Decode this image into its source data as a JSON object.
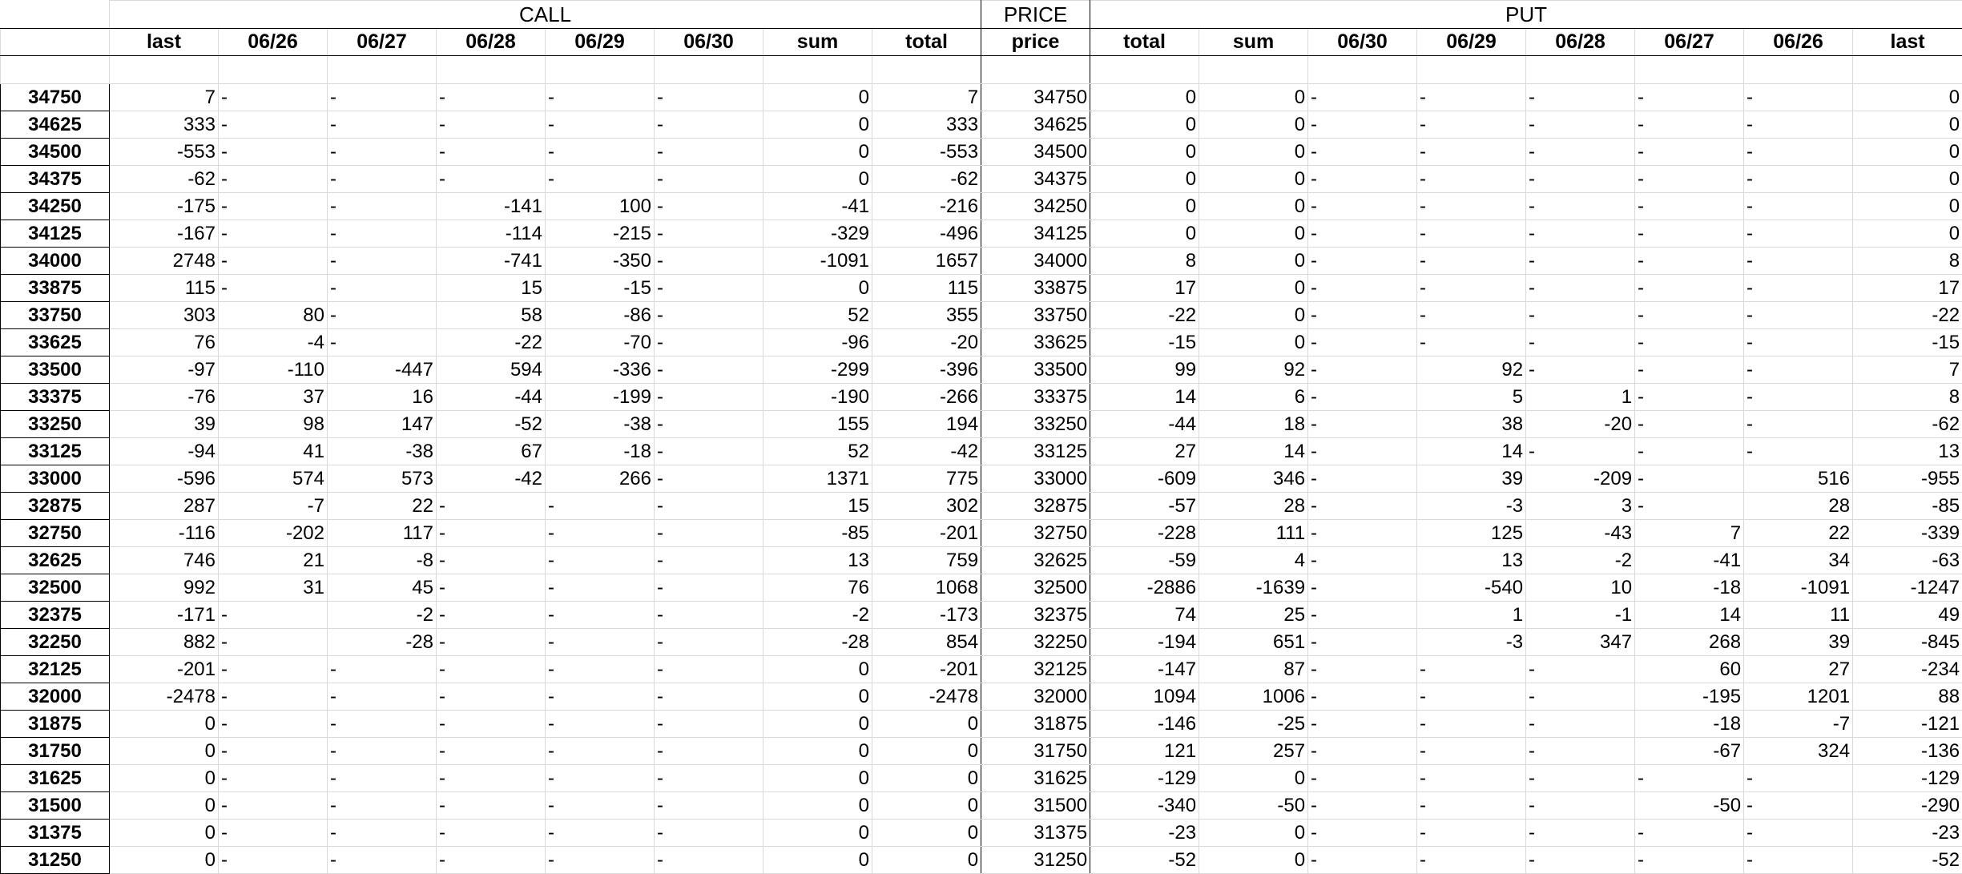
{
  "groups": {
    "call": "CALL",
    "price": "PRICE",
    "put": "PUT"
  },
  "headers": [
    "",
    "last",
    "06/26",
    "06/27",
    "06/28",
    "06/29",
    "06/30",
    "sum",
    "total",
    "price",
    "total",
    "sum",
    "06/30",
    "06/29",
    "06/28",
    "06/27",
    "06/26",
    "last"
  ],
  "rows": [
    [
      "34750",
      "7",
      "-",
      "-",
      "-",
      "-",
      "-",
      "0",
      "7",
      "34750",
      "0",
      "0",
      "-",
      "-",
      "-",
      "-",
      "-",
      "0"
    ],
    [
      "34625",
      "333",
      "-",
      "-",
      "-",
      "-",
      "-",
      "0",
      "333",
      "34625",
      "0",
      "0",
      "-",
      "-",
      "-",
      "-",
      "-",
      "0"
    ],
    [
      "34500",
      "-553",
      "-",
      "-",
      "-",
      "-",
      "-",
      "0",
      "-553",
      "34500",
      "0",
      "0",
      "-",
      "-",
      "-",
      "-",
      "-",
      "0"
    ],
    [
      "34375",
      "-62",
      "-",
      "-",
      "-",
      "-",
      "-",
      "0",
      "-62",
      "34375",
      "0",
      "0",
      "-",
      "-",
      "-",
      "-",
      "-",
      "0"
    ],
    [
      "34250",
      "-175",
      "-",
      "-",
      "-141",
      "100",
      "-",
      "-41",
      "-216",
      "34250",
      "0",
      "0",
      "-",
      "-",
      "-",
      "-",
      "-",
      "0"
    ],
    [
      "34125",
      "-167",
      "-",
      "-",
      "-114",
      "-215",
      "-",
      "-329",
      "-496",
      "34125",
      "0",
      "0",
      "-",
      "-",
      "-",
      "-",
      "-",
      "0"
    ],
    [
      "34000",
      "2748",
      "-",
      "-",
      "-741",
      "-350",
      "-",
      "-1091",
      "1657",
      "34000",
      "8",
      "0",
      "-",
      "-",
      "-",
      "-",
      "-",
      "8"
    ],
    [
      "33875",
      "115",
      "-",
      "-",
      "15",
      "-15",
      "-",
      "0",
      "115",
      "33875",
      "17",
      "0",
      "-",
      "-",
      "-",
      "-",
      "-",
      "17"
    ],
    [
      "33750",
      "303",
      "80",
      "-",
      "58",
      "-86",
      "-",
      "52",
      "355",
      "33750",
      "-22",
      "0",
      "-",
      "-",
      "-",
      "-",
      "-",
      "-22"
    ],
    [
      "33625",
      "76",
      "-4",
      "-",
      "-22",
      "-70",
      "-",
      "-96",
      "-20",
      "33625",
      "-15",
      "0",
      "-",
      "-",
      "-",
      "-",
      "-",
      "-15"
    ],
    [
      "33500",
      "-97",
      "-110",
      "-447",
      "594",
      "-336",
      "-",
      "-299",
      "-396",
      "33500",
      "99",
      "92",
      "-",
      "92",
      "-",
      "-",
      "-",
      "7"
    ],
    [
      "33375",
      "-76",
      "37",
      "16",
      "-44",
      "-199",
      "-",
      "-190",
      "-266",
      "33375",
      "14",
      "6",
      "-",
      "5",
      "1",
      "-",
      "-",
      "8"
    ],
    [
      "33250",
      "39",
      "98",
      "147",
      "-52",
      "-38",
      "-",
      "155",
      "194",
      "33250",
      "-44",
      "18",
      "-",
      "38",
      "-20",
      "-",
      "-",
      "-62"
    ],
    [
      "33125",
      "-94",
      "41",
      "-38",
      "67",
      "-18",
      "-",
      "52",
      "-42",
      "33125",
      "27",
      "14",
      "-",
      "14",
      "-",
      "-",
      "-",
      "13"
    ],
    [
      "33000",
      "-596",
      "574",
      "573",
      "-42",
      "266",
      "-",
      "1371",
      "775",
      "33000",
      "-609",
      "346",
      "-",
      "39",
      "-209",
      "-",
      "516",
      "-955"
    ],
    [
      "32875",
      "287",
      "-7",
      "22",
      "-",
      "-",
      "-",
      "15",
      "302",
      "32875",
      "-57",
      "28",
      "-",
      "-3",
      "3",
      "-",
      "28",
      "-85"
    ],
    [
      "32750",
      "-116",
      "-202",
      "117",
      "-",
      "-",
      "-",
      "-85",
      "-201",
      "32750",
      "-228",
      "111",
      "-",
      "125",
      "-43",
      "7",
      "22",
      "-339"
    ],
    [
      "32625",
      "746",
      "21",
      "-8",
      "-",
      "-",
      "-",
      "13",
      "759",
      "32625",
      "-59",
      "4",
      "-",
      "13",
      "-2",
      "-41",
      "34",
      "-63"
    ],
    [
      "32500",
      "992",
      "31",
      "45",
      "-",
      "-",
      "-",
      "76",
      "1068",
      "32500",
      "-2886",
      "-1639",
      "-",
      "-540",
      "10",
      "-18",
      "-1091",
      "-1247"
    ],
    [
      "32375",
      "-171",
      "-",
      "-2",
      "-",
      "-",
      "-",
      "-2",
      "-173",
      "32375",
      "74",
      "25",
      "-",
      "1",
      "-1",
      "14",
      "11",
      "49"
    ],
    [
      "32250",
      "882",
      "-",
      "-28",
      "-",
      "-",
      "-",
      "-28",
      "854",
      "32250",
      "-194",
      "651",
      "-",
      "-3",
      "347",
      "268",
      "39",
      "-845"
    ],
    [
      "32125",
      "-201",
      "-",
      "-",
      "-",
      "-",
      "-",
      "0",
      "-201",
      "32125",
      "-147",
      "87",
      "-",
      "-",
      "-",
      "60",
      "27",
      "-234"
    ],
    [
      "32000",
      "-2478",
      "-",
      "-",
      "-",
      "-",
      "-",
      "0",
      "-2478",
      "32000",
      "1094",
      "1006",
      "-",
      "-",
      "-",
      "-195",
      "1201",
      "88"
    ],
    [
      "31875",
      "0",
      "-",
      "-",
      "-",
      "-",
      "-",
      "0",
      "0",
      "31875",
      "-146",
      "-25",
      "-",
      "-",
      "-",
      "-18",
      "-7",
      "-121"
    ],
    [
      "31750",
      "0",
      "-",
      "-",
      "-",
      "-",
      "-",
      "0",
      "0",
      "31750",
      "121",
      "257",
      "-",
      "-",
      "-",
      "-67",
      "324",
      "-136"
    ],
    [
      "31625",
      "0",
      "-",
      "-",
      "-",
      "-",
      "-",
      "0",
      "0",
      "31625",
      "-129",
      "0",
      "-",
      "-",
      "-",
      "-",
      "-",
      "-129"
    ],
    [
      "31500",
      "0",
      "-",
      "-",
      "-",
      "-",
      "-",
      "0",
      "0",
      "31500",
      "-340",
      "-50",
      "-",
      "-",
      "-",
      "-50",
      "-",
      "-290"
    ],
    [
      "31375",
      "0",
      "-",
      "-",
      "-",
      "-",
      "-",
      "0",
      "0",
      "31375",
      "-23",
      "0",
      "-",
      "-",
      "-",
      "-",
      "-",
      "-23"
    ],
    [
      "31250",
      "0",
      "-",
      "-",
      "-",
      "-",
      "-",
      "0",
      "0",
      "31250",
      "-52",
      "0",
      "-",
      "-",
      "-",
      "-",
      "-",
      "-52"
    ]
  ]
}
